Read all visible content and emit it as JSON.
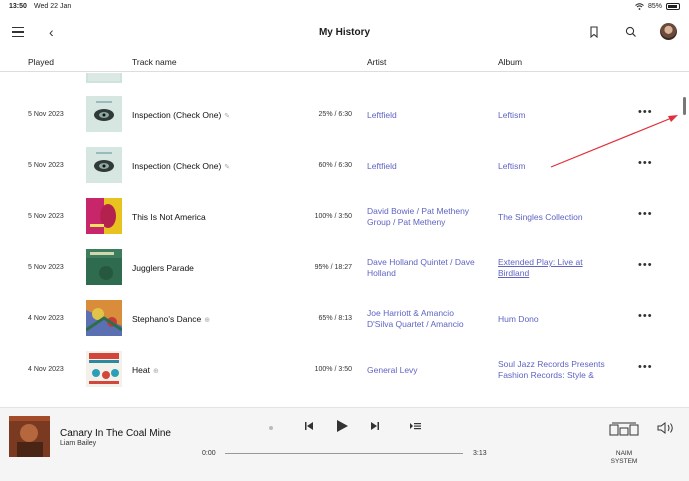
{
  "status": {
    "time": "13:50",
    "date": "Wed 22 Jan",
    "battery": "85%"
  },
  "header": {
    "title": "My History"
  },
  "columns": {
    "played": "Played",
    "track": "Track name",
    "artist": "Artist",
    "album": "Album"
  },
  "rows": [
    {
      "played": "5 Nov 2023",
      "track": "Inspection (Check One)",
      "sym": "✎",
      "progress": "25% / 6:30",
      "artist": "Leftfield",
      "album": "Leftism"
    },
    {
      "played": "5 Nov 2023",
      "track": "Inspection (Check One)",
      "sym": "✎",
      "progress": "60% / 6:30",
      "artist": "Leftfield",
      "album": "Leftism"
    },
    {
      "played": "5 Nov 2023",
      "track": "This Is Not America",
      "progress": "100% / 3:50",
      "artist_parts": [
        "David Bowie",
        " / ",
        "Pat Metheny",
        " Group / ",
        "Pat Metheny"
      ],
      "artist": "David Bowie / Pat Metheny Group / Pat Metheny",
      "album": "The Singles Collection"
    },
    {
      "played": "5 Nov 2023",
      "track": "Jugglers Parade",
      "progress": "95% / 18:27",
      "artist": "Dave Holland Quintet / Dave Holland",
      "album": "Extended Play: Live at Birdland"
    },
    {
      "played": "4 Nov 2023",
      "track": "Stephano's Dance",
      "sym": "⊕",
      "progress": "65% / 8:13",
      "artist": "Joe Harriott & Amancio D'Silva Quartet / Amancio",
      "album": "Hum Dono"
    },
    {
      "played": "4 Nov 2023",
      "track": "Heat",
      "sym": "⊕",
      "progress": "100% / 3:50",
      "artist": "General Levy",
      "album": "Soul Jazz Records Presents Fashion Records: Style &"
    }
  ],
  "player": {
    "title": "Canary In The Coal Mine",
    "artist": "Liam Bailey",
    "elapsed": "0:00",
    "duration": "3:13",
    "device_line1": "NAIM",
    "device_line2": "SYSTEM"
  },
  "colors": {
    "link": "#5f64c2",
    "annotation_arrow": "#e0303a"
  }
}
